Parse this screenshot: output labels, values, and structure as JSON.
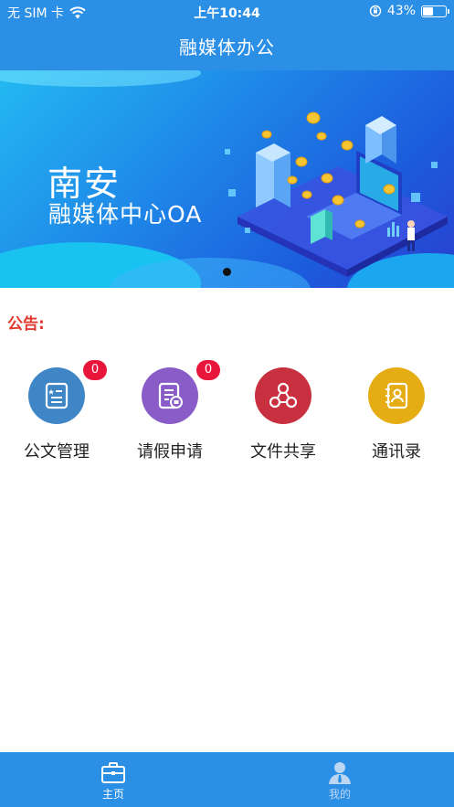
{
  "status_bar": {
    "carrier": "无 SIM 卡",
    "time": "上午10:44",
    "battery_percent": "43%",
    "battery_level": 0.43,
    "icons": [
      "wifi-icon",
      "orientation-lock-icon",
      "battery-icon"
    ]
  },
  "nav": {
    "title": "融媒体办公"
  },
  "banner": {
    "line1": "南安",
    "line2": "融媒体中心OA",
    "page_count": 1,
    "current_page": 1
  },
  "notice": {
    "label": "公告:"
  },
  "grid": {
    "items": [
      {
        "label": "公文管理",
        "badge": "0",
        "icon": "document-list-icon",
        "color": "#3f86c7"
      },
      {
        "label": "请假申请",
        "badge": "0",
        "icon": "leave-form-icon",
        "color": "#8a5cc8"
      },
      {
        "label": "文件共享",
        "badge": null,
        "icon": "share-nodes-icon",
        "color": "#c9303f"
      },
      {
        "label": "通讯录",
        "badge": null,
        "icon": "contacts-book-icon",
        "color": "#e6ac14"
      }
    ]
  },
  "tabbar": {
    "tabs": [
      {
        "label": "主页",
        "icon": "briefcase-icon",
        "active": true
      },
      {
        "label": "我的",
        "icon": "person-icon",
        "active": false
      }
    ]
  },
  "colors": {
    "primary": "#2b8fe6",
    "notice": "#e13b2f",
    "badge": "#e8163b"
  }
}
